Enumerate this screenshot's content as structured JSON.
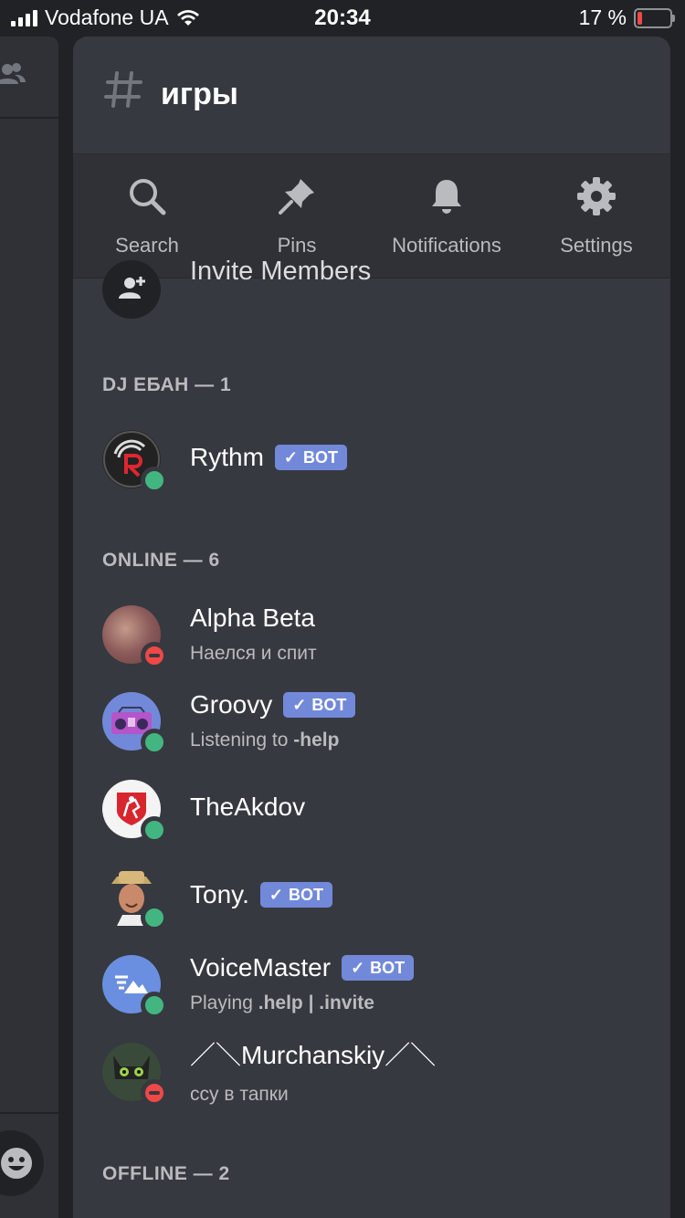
{
  "status_bar": {
    "carrier": "Vodafone UA",
    "time": "20:34",
    "battery": "17 %",
    "battery_color": "#f04747"
  },
  "channel": {
    "name": "игры",
    "icon": "hash-icon"
  },
  "toolbar": {
    "search": "Search",
    "pins": "Pins",
    "notifications": "Notifications",
    "settings": "Settings"
  },
  "invite": {
    "label": "Invite Members",
    "icon": "add-user-icon"
  },
  "sections": {
    "dj": "DJ ЕБАН — 1",
    "online": "ONLINE — 6",
    "offline": "OFFLINE — 2"
  },
  "bot_badge": "BOT",
  "members": {
    "rythm": {
      "name": "Rythm",
      "status": "online"
    },
    "alpha": {
      "name": "Alpha Beta",
      "activity": "Наелся и спит",
      "status": "dnd"
    },
    "groovy": {
      "name": "Groovy",
      "activity_prefix": "Listening to",
      "activity_bold": "-help",
      "status": "online"
    },
    "theakdov": {
      "name": "TheAkdov",
      "status": "online"
    },
    "tony": {
      "name": "Tony.",
      "status": "online"
    },
    "voicemaster": {
      "name": "VoiceMaster",
      "activity_prefix": "Playing",
      "activity_bold": ".help | .invite",
      "status": "online"
    },
    "murchanskiy": {
      "name": "／＼Murchanskiy／＼",
      "activity": "ссу в тапки",
      "status": "dnd"
    }
  },
  "colors": {
    "accent": "#7289da",
    "online": "#43b581",
    "dnd": "#f04747",
    "panel": "#36393f",
    "toolbar": "#2f3136"
  }
}
